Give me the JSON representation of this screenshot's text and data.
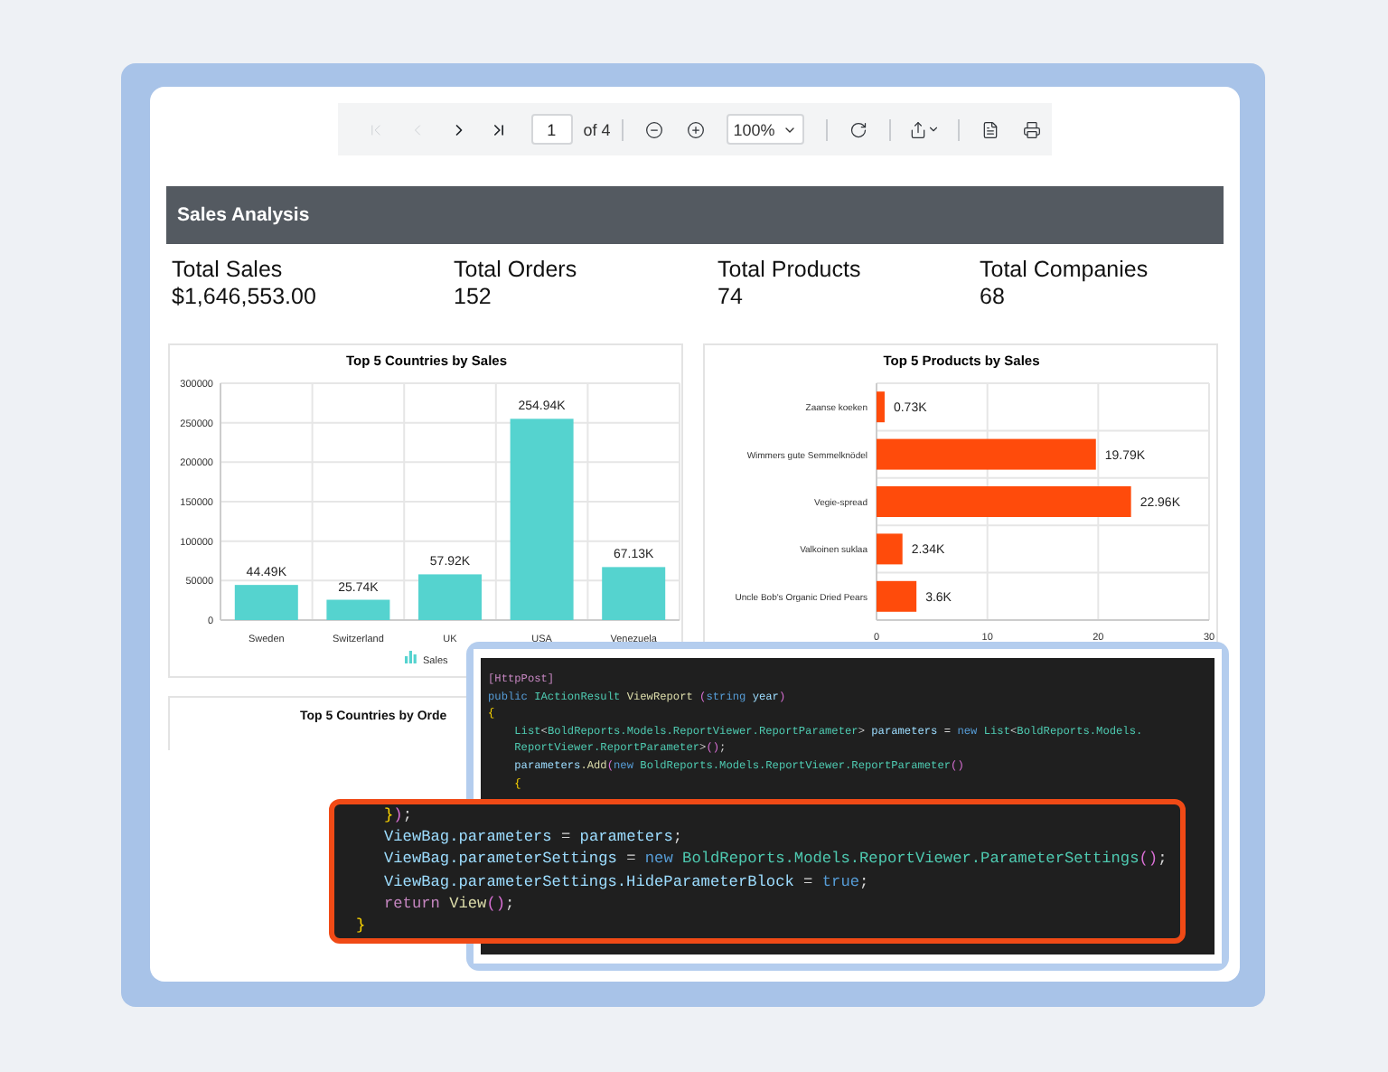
{
  "toolbar": {
    "nav": [
      {
        "kind": "first",
        "disabled": true
      },
      {
        "kind": "previous",
        "disabled": true
      },
      {
        "kind": "next",
        "disabled": false
      },
      {
        "kind": "last",
        "disabled": false
      }
    ],
    "page": "1",
    "page_count": "of 4",
    "zoom": "100%"
  },
  "report": {
    "title": "Sales Analysis",
    "kpis": [
      {
        "label": "Total Sales",
        "value": "$1,646,553.00"
      },
      {
        "label": "Total Orders",
        "value": "152"
      },
      {
        "label": "Total Products",
        "value": "74"
      },
      {
        "label": "Total Companies",
        "value": "68"
      }
    ],
    "charts": [
      {
        "chart_data": {
          "type": "bar",
          "title": "Top 5 Countries by Sales",
          "categories": [
            "Sweden",
            "Switzerland",
            "UK",
            "USA",
            "Venezuela"
          ],
          "series": [
            {
              "name": "Sales",
              "color": "#55d3cf",
              "values": [
                44490,
                25740,
                57920,
                254940,
                67130
              ]
            }
          ],
          "grid": true,
          "ylim": [
            0,
            300000
          ],
          "yticks": [
            0,
            50000,
            100000,
            150000,
            200000,
            250000,
            300000
          ],
          "value_labels": [
            "44.49K",
            "25.74K",
            "57.92K",
            "254.94K",
            "67.13K"
          ]
        }
      },
      {
        "chart_data": {
          "type": "bar",
          "orientation": "horizontal",
          "title": "Top 5 Products by Sales",
          "categories": [
            "Zaanse koeken",
            "Wimmers gute Semmelknödel",
            "Vegie-spread",
            "Valkoinen suklaa",
            "Uncle Bob's Organic Dried Pears"
          ],
          "series": [
            {
              "color": "#ff4b0b",
              "values": [
                0.73,
                19.79,
                22.96,
                2.34,
                3.6
              ]
            }
          ],
          "grid": true,
          "xlim": [
            0,
            30
          ],
          "xticks": [
            0,
            10,
            20,
            30
          ],
          "value_labels": [
            "0.73K",
            "19.79K",
            "22.96K",
            "2.34K",
            "3.6K"
          ]
        }
      }
    ],
    "partial_card": {
      "title": "Top 5 Countries by Orde"
    }
  },
  "editor_lines": [
    {
      "tokens": [
        {
          "kind": "attribute",
          "text": "[HttpPost]"
        }
      ]
    },
    {
      "tokens": [
        {
          "kind": "keyword",
          "text": "public"
        },
        {
          "kind": "type",
          "text": " IActionResult"
        },
        {
          "kind": "method",
          "text": " ViewReport"
        },
        {
          "kind": "paren",
          "text": " ("
        },
        {
          "kind": "keyword",
          "text": "string"
        },
        {
          "kind": "ident",
          "text": " year"
        },
        {
          "kind": "paren",
          "text": ")"
        }
      ]
    },
    {
      "tokens": [
        {
          "kind": "brace",
          "text": "{"
        }
      ]
    },
    {
      "tokens": [
        {
          "kind": "type",
          "text": "    List"
        },
        {
          "kind": "plain",
          "text": "<"
        },
        {
          "kind": "type",
          "text": "BoldReports.Models.ReportViewer.ReportParameter"
        },
        {
          "kind": "plain",
          "text": ">"
        },
        {
          "kind": "ident",
          "text": " parameters"
        },
        {
          "kind": "plain",
          "text": " = "
        },
        {
          "kind": "keyword",
          "text": "new"
        },
        {
          "kind": "type",
          "text": " List"
        },
        {
          "kind": "plain",
          "text": "<"
        },
        {
          "kind": "type",
          "text": "BoldReports.Models."
        }
      ]
    },
    {
      "tokens": [
        {
          "kind": "type",
          "text": "    ReportViewer.ReportParameter"
        },
        {
          "kind": "plain",
          "text": ">"
        },
        {
          "kind": "paren",
          "text": "()"
        },
        {
          "kind": "plain",
          "text": ";"
        }
      ]
    },
    {
      "tokens": [
        {
          "kind": "ident",
          "text": "    parameters"
        },
        {
          "kind": "method",
          "text": ".Add"
        },
        {
          "kind": "paren",
          "text": "("
        },
        {
          "kind": "keyword",
          "text": "new"
        },
        {
          "kind": "type",
          "text": " BoldReports.Models.ReportViewer.ReportParameter"
        },
        {
          "kind": "paren",
          "text": "()"
        }
      ]
    },
    {
      "tokens": [
        {
          "kind": "brace",
          "text": "    {"
        }
      ]
    }
  ],
  "callout_lines": [
    {
      "tokens": [
        {
          "kind": "brace",
          "text": "   }"
        },
        {
          "kind": "paren",
          "text": ")"
        },
        {
          "kind": "plain",
          "text": ";"
        }
      ]
    },
    {
      "tokens": [
        {
          "kind": "ident",
          "text": "   ViewBag.parameters"
        },
        {
          "kind": "plain",
          "text": " = "
        },
        {
          "kind": "ident",
          "text": "parameters"
        },
        {
          "kind": "plain",
          "text": ";"
        }
      ]
    },
    {
      "tokens": [
        {
          "kind": "ident",
          "text": "   ViewBag.parameterSettings"
        },
        {
          "kind": "plain",
          "text": " = "
        },
        {
          "kind": "keyword",
          "text": "new"
        },
        {
          "kind": "type",
          "text": " BoldReports.Models.ReportViewer.ParameterSettings"
        },
        {
          "kind": "paren",
          "text": "()"
        },
        {
          "kind": "plain",
          "text": ";"
        }
      ]
    },
    {
      "tokens": [
        {
          "kind": "ident",
          "text": "   ViewBag.parameterSettings.HideParameterBlock"
        },
        {
          "kind": "plain",
          "text": " = "
        },
        {
          "kind": "keyword",
          "text": "true"
        },
        {
          "kind": "plain",
          "text": ";"
        }
      ]
    },
    {
      "tokens": [
        {
          "kind": "control",
          "text": "   return"
        },
        {
          "kind": "method",
          "text": " View"
        },
        {
          "kind": "paren",
          "text": "()"
        },
        {
          "kind": "plain",
          "text": ";"
        }
      ]
    },
    {
      "tokens": [
        {
          "kind": "brace",
          "text": "}"
        }
      ]
    }
  ]
}
